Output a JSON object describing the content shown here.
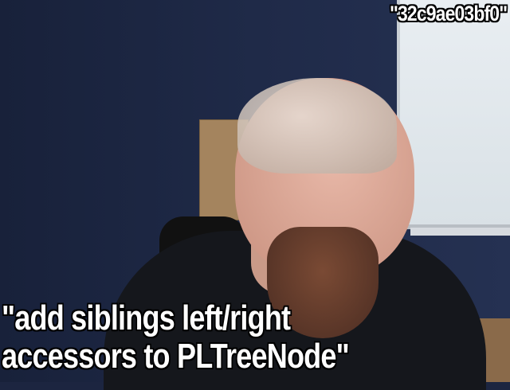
{
  "overlay": {
    "hash": "\"32c9ae03bf0\"",
    "message_line1": "\"add siblings left/right",
    "message_line2": "accessors to PLTreeNode\""
  },
  "colors": {
    "wall": "#1f2a48",
    "caption_text": "#ffffff",
    "caption_outline": "#000000"
  }
}
